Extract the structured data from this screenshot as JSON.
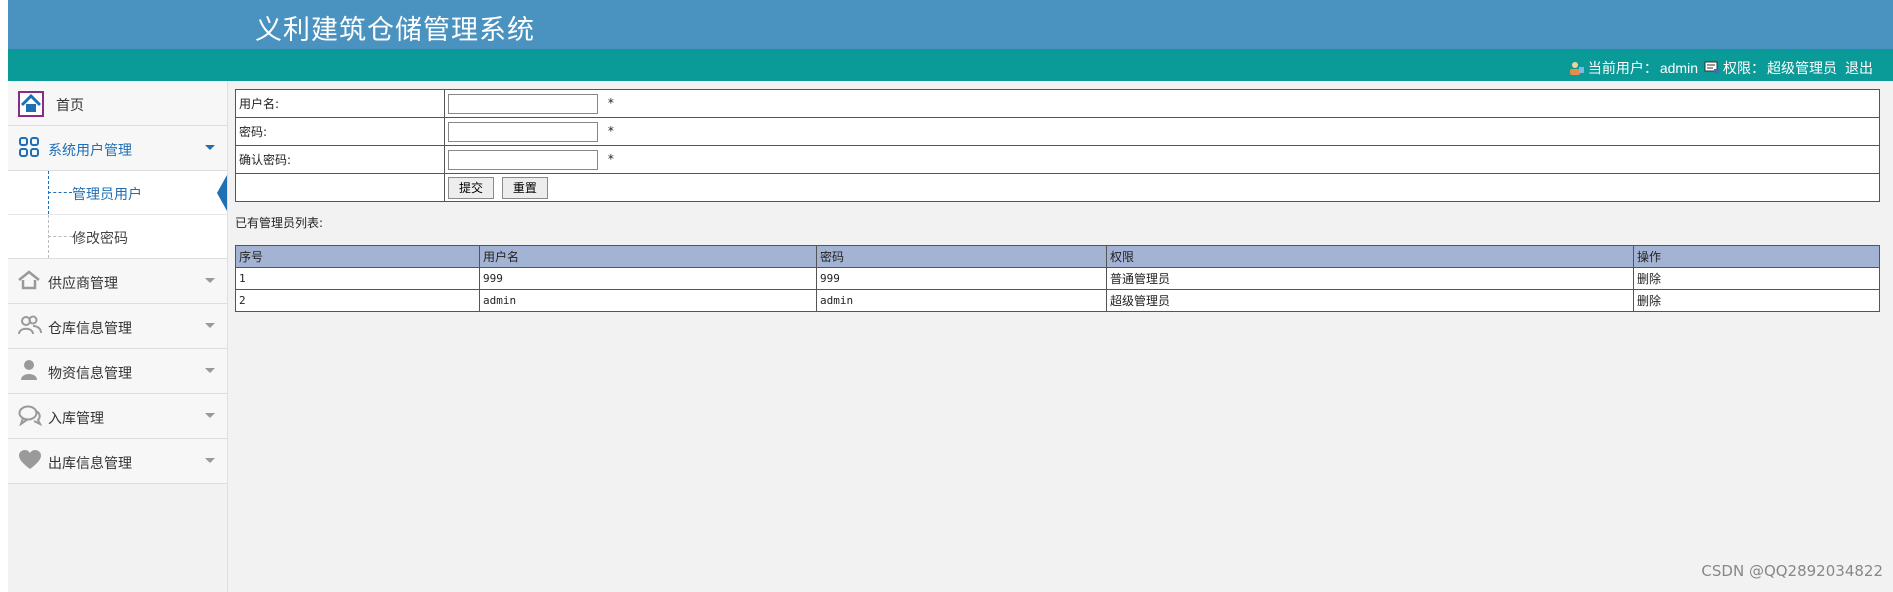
{
  "header": {
    "title": "义利建筑仓储管理系统"
  },
  "userbar": {
    "current_user_label": "当前用户：",
    "current_user": "admin",
    "role_label": "权限：",
    "role": "超级管理员",
    "logout": "退出"
  },
  "sidebar": {
    "home": "首页",
    "system_users": "系统用户管理",
    "sub": {
      "admin_users": "管理员用户",
      "change_password": "修改密码"
    },
    "supplier": "供应商管理",
    "warehouse": "仓库信息管理",
    "materials": "物资信息管理",
    "inbound": "入库管理",
    "outbound": "出库信息管理"
  },
  "form": {
    "username_label": "用户名:",
    "password_label": "密码:",
    "confirm_label": "确认密码:",
    "required_mark": "*",
    "submit": "提交",
    "reset": "重置"
  },
  "list": {
    "title": "已有管理员列表:",
    "headers": [
      "序号",
      "用户名",
      "密码",
      "权限",
      "操作"
    ],
    "rows": [
      [
        "1",
        "999",
        "999",
        "普通管理员",
        "删除"
      ],
      [
        "2",
        "admin",
        "admin",
        "超级管理员",
        "删除"
      ]
    ]
  },
  "watermark": "CSDN @QQ2892034822",
  "colors": {
    "header": "#4a92bf",
    "subbar": "#0a9a98",
    "accent": "#1f6fb4",
    "table_header": "#a3b3d4"
  }
}
